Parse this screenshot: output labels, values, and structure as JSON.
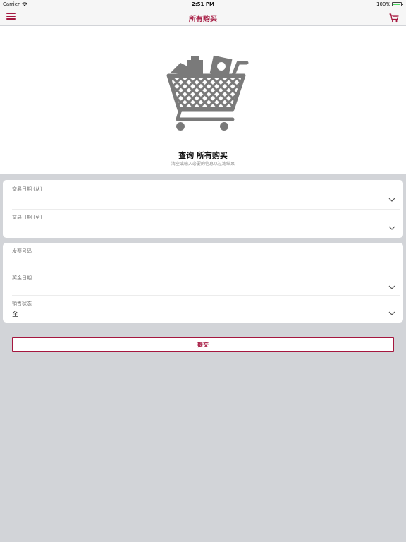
{
  "status_bar": {
    "carrier": "Carrier",
    "time": "2:51 PM",
    "battery": "100%"
  },
  "nav": {
    "title": "所有购买",
    "menu_icon": "hamburger-menu-icon",
    "cart_icon": "shopping-cart-icon"
  },
  "hero": {
    "illustration": "shopping-cart-full-icon",
    "heading": "查询 所有购买",
    "subheading": "清空或输入必要的信息以过滤结果"
  },
  "form": {
    "date_from_label": "交易日期 (从)",
    "date_from_value": "",
    "date_to_label": "交易日期 (至)",
    "date_to_value": "",
    "invoice_label": "发票号码",
    "invoice_value": "",
    "award_date_label": "奖金日期",
    "award_date_value": "",
    "sales_status_label": "销售状态",
    "sales_status_value": "全"
  },
  "submit_label": "提交",
  "colors": {
    "accent": "#a5173f",
    "background": "#d2d4d8",
    "card": "#ffffff",
    "icon_gray": "#777777"
  }
}
